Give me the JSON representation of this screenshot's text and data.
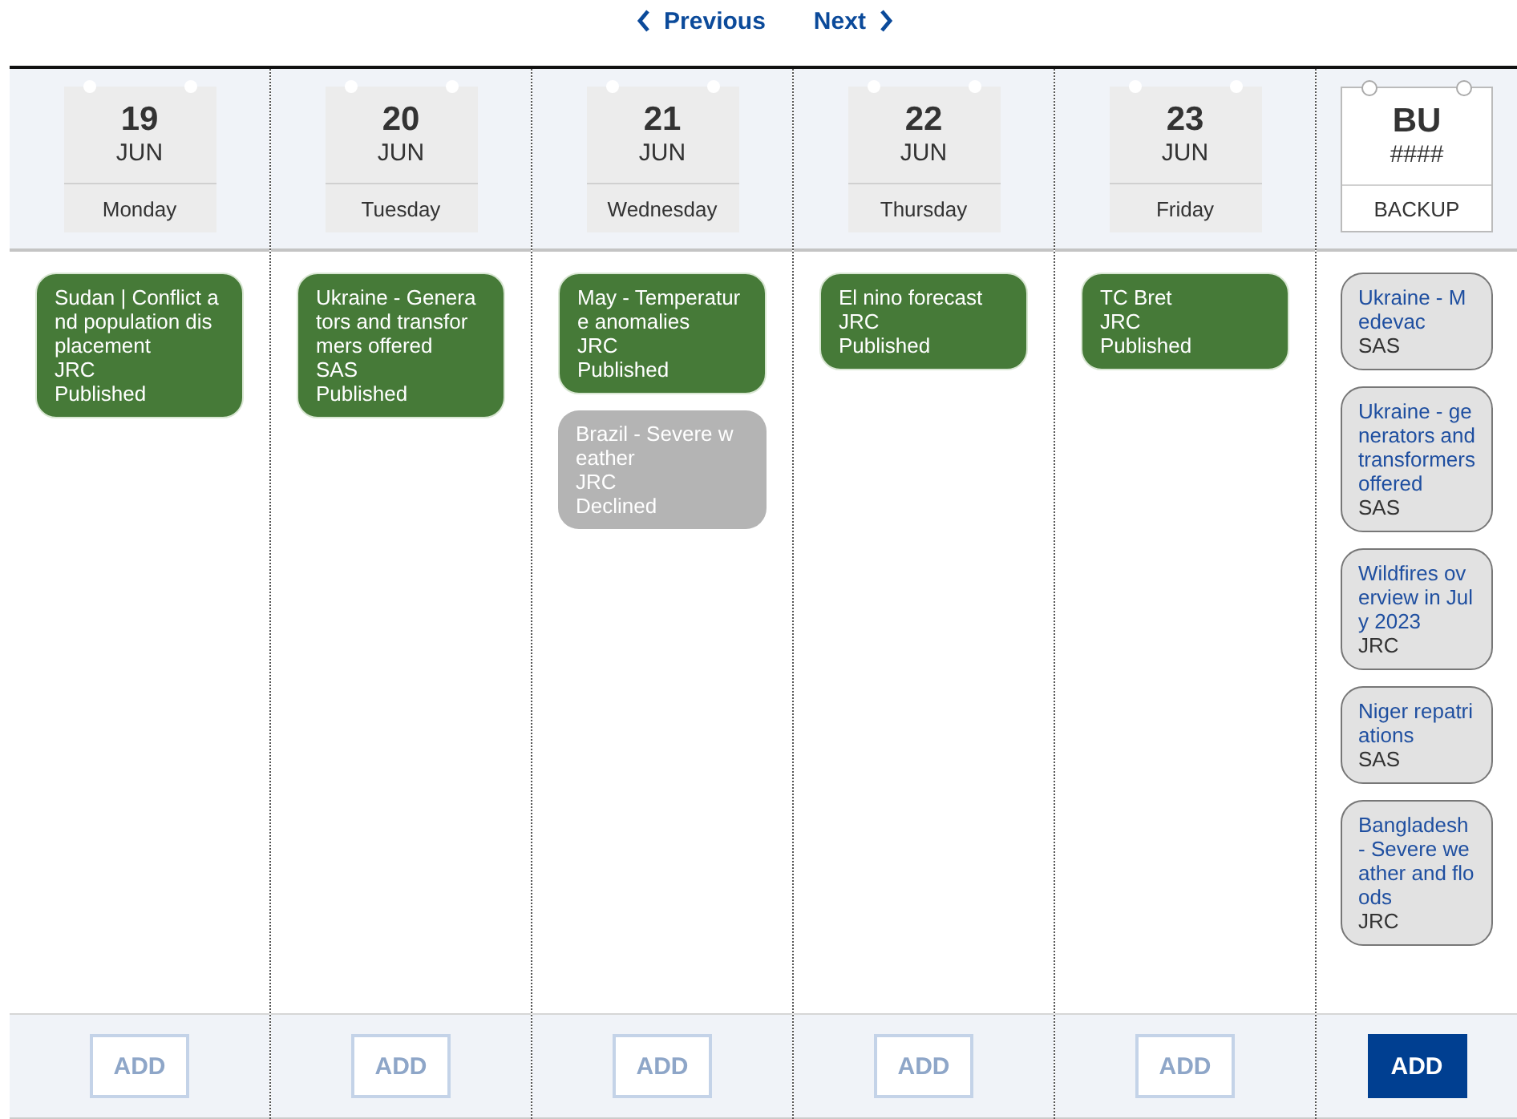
{
  "nav": {
    "previous": "Previous",
    "next": "Next"
  },
  "columns": [
    {
      "kind": "day",
      "day": "19",
      "month": "JUN",
      "label": "Monday",
      "add": {
        "label": "ADD",
        "disabled": true
      },
      "cards": [
        {
          "kind": "published",
          "title": "Sudan | Conflict and population displacement",
          "org": "JRC",
          "status": "Published"
        }
      ]
    },
    {
      "kind": "day",
      "day": "20",
      "month": "JUN",
      "label": "Tuesday",
      "add": {
        "label": "ADD",
        "disabled": true
      },
      "cards": [
        {
          "kind": "published",
          "title": "Ukraine - Generators and transformers offered",
          "org": "SAS",
          "status": "Published"
        }
      ]
    },
    {
      "kind": "day",
      "day": "21",
      "month": "JUN",
      "label": "Wednesday",
      "add": {
        "label": "ADD",
        "disabled": true
      },
      "cards": [
        {
          "kind": "published",
          "title": "May - Temperature anomalies",
          "org": "JRC",
          "status": "Published"
        },
        {
          "kind": "declined",
          "title": "Brazil - Severe weather",
          "org": "JRC",
          "status": "Declined"
        }
      ]
    },
    {
      "kind": "day",
      "day": "22",
      "month": "JUN",
      "label": "Thursday",
      "add": {
        "label": "ADD",
        "disabled": true
      },
      "cards": [
        {
          "kind": "published",
          "title": "El nino forecast",
          "org": "JRC",
          "status": "Published"
        }
      ]
    },
    {
      "kind": "day",
      "day": "23",
      "month": "JUN",
      "label": "Friday",
      "add": {
        "label": "ADD",
        "disabled": true
      },
      "cards": [
        {
          "kind": "published",
          "title": "TC Bret",
          "org": "JRC",
          "status": "Published"
        }
      ]
    },
    {
      "kind": "backup",
      "day": "BU",
      "month": "####",
      "label": "BACKUP",
      "add": {
        "label": "ADD",
        "disabled": false
      },
      "cards": [
        {
          "kind": "backup",
          "title": "Ukraine - Medevac",
          "org": "SAS"
        },
        {
          "kind": "backup",
          "title": "Ukraine - generators and transformers offered",
          "org": "SAS"
        },
        {
          "kind": "backup",
          "title": "Wildfires overview in July 2023",
          "org": "JRC"
        },
        {
          "kind": "backup",
          "title": "Niger repatriations",
          "org": "SAS"
        },
        {
          "kind": "backup",
          "title": "Bangladesh - Severe weather and floods",
          "org": "JRC"
        }
      ]
    }
  ]
}
